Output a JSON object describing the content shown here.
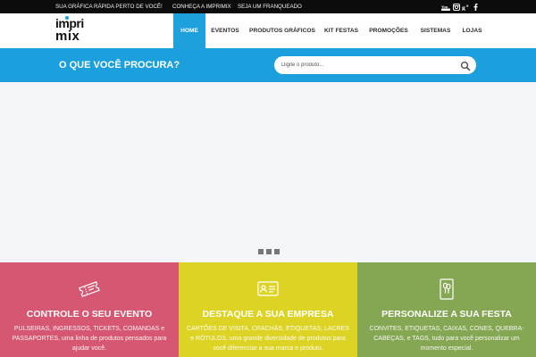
{
  "topbar": {
    "links": [
      "SUA GRÁFICA RÁPIDA PERTO DE VOCÊ!",
      "CONHEÇA A IMPRIMIX",
      "SEJA UM FRANQUEADO"
    ],
    "social": [
      "youtube-icon",
      "instagram-icon",
      "google-plus-icon",
      "facebook-icon"
    ]
  },
  "logo": {
    "line1": "impri",
    "line2": "mix"
  },
  "nav": {
    "items": [
      "HOME",
      "EVENTOS",
      "PRODUTOS GRÁFICOS",
      "KIT FESTAS",
      "PROMOÇÕES",
      "SISTEMAS",
      "LOJAS"
    ],
    "active": "HOME"
  },
  "search": {
    "question": "O QUE VOCÊ PROCURA?",
    "placeholder": "Digite o produto...",
    "value": "",
    "icon": "search-icon"
  },
  "slider": {
    "dots": 3
  },
  "features": [
    {
      "icon": "ticket-icon",
      "title": "CONTROLE O SEU EVENTO",
      "text": "PULSEIRAS, INGRESSOS, TICKETS, COMANDAS e PASSAPORTES, uma linha de produtos pensados para ajudar você.",
      "color": "#d55771"
    },
    {
      "icon": "id-card-icon",
      "title": "DESTAQUE A SUA EMPRESA",
      "text": "CARTÕES DE VISITA, CRACHÁS, ETIQUETAS, LACRES e RÓTULOS, uma grande diversidade de produtos para você diferenciar a sua marca e produto.",
      "color": "#ddd325"
    },
    {
      "icon": "party-card-icon",
      "title": "PERSONALIZE A SUA FESTA",
      "text": "CONVITES, ETIQUETAS, CAIXAS, CONES, QUEBRA-CABEÇAS, e TAGS, tudo para você personalizar um momento especial.",
      "color": "#85a653"
    }
  ],
  "colors": {
    "accent": "#1ca0dd",
    "topbar": "#0c0c0c"
  }
}
